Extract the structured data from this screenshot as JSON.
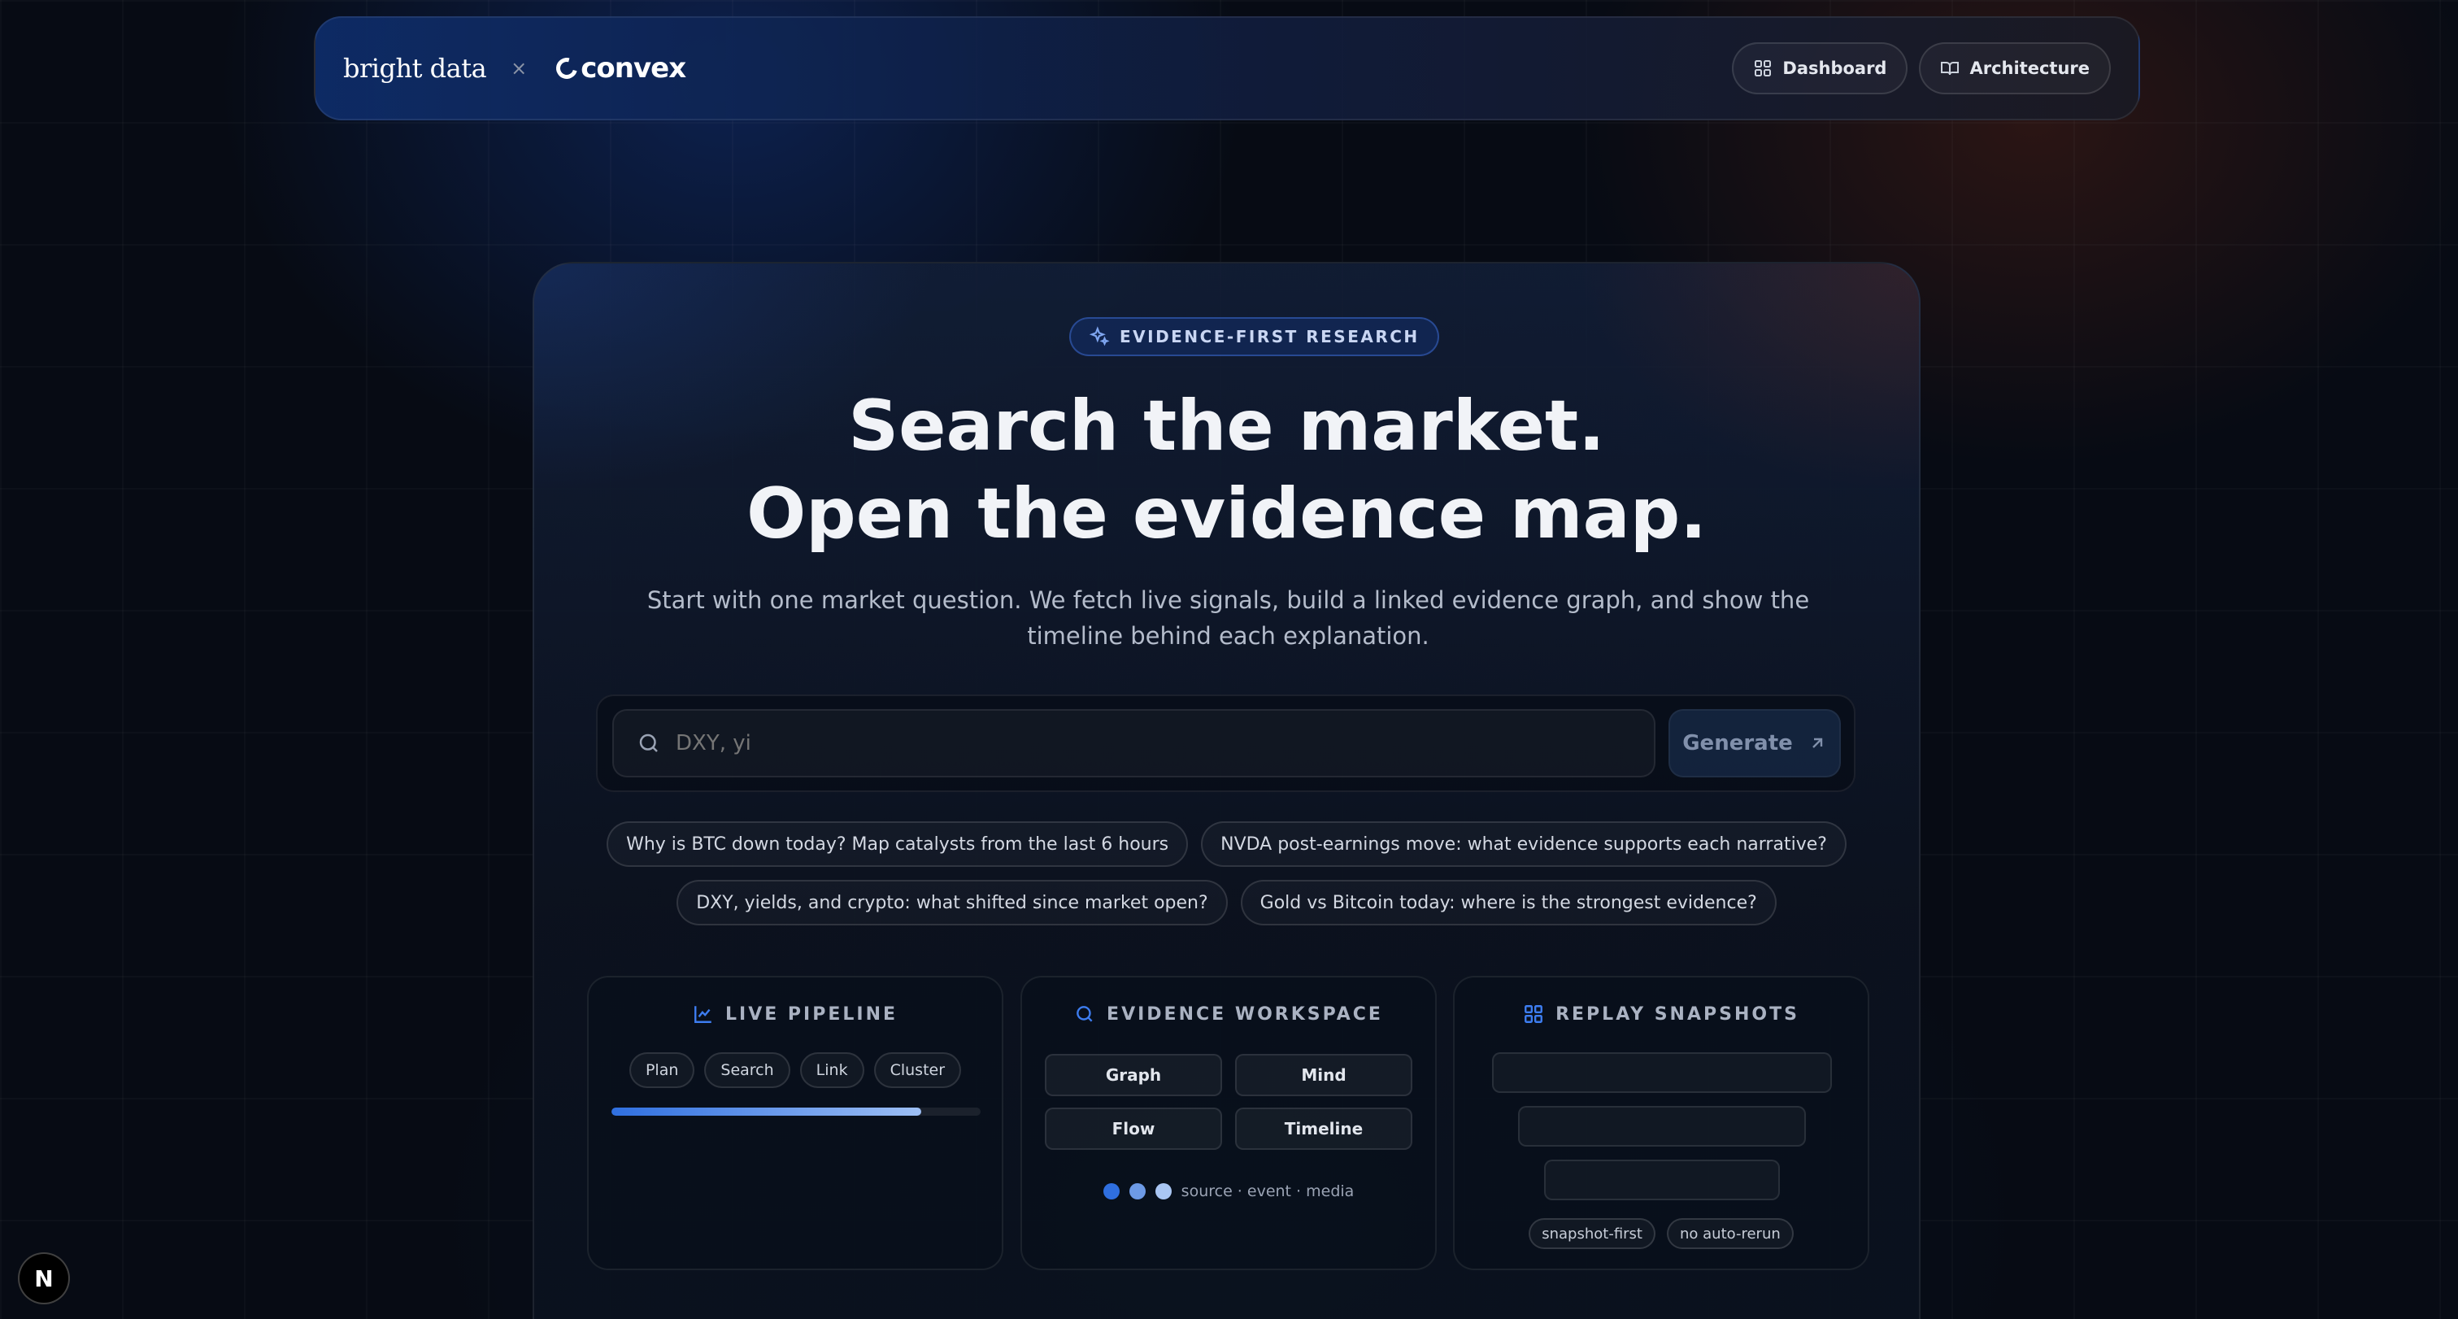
{
  "nav": {
    "brand_left": "bright data",
    "separator": "×",
    "brand_right": "convex",
    "dashboard_label": "Dashboard",
    "architecture_label": "Architecture"
  },
  "hero": {
    "badge": "EVIDENCE-FIRST RESEARCH",
    "title_line1": "Search the market.",
    "title_line2": "Open the evidence map.",
    "subtitle": "Start with one market question. We fetch live signals, build a linked evidence graph, and show the timeline behind each explanation."
  },
  "search": {
    "value": "",
    "placeholder": "DXY, yi",
    "generate_label": "Generate"
  },
  "suggestions": [
    "Why is BTC down today? Map catalysts from the last 6 hours",
    "NVDA post-earnings move: what evidence supports each narrative?",
    "DXY, yields, and crypto: what shifted since market open?",
    "Gold vs Bitcoin today: where is the strongest evidence?"
  ],
  "panels": {
    "pipeline": {
      "title": "LIVE PIPELINE",
      "steps": [
        "Plan",
        "Search",
        "Link",
        "Cluster"
      ],
      "progress": 0.84
    },
    "workspace": {
      "title": "EVIDENCE WORKSPACE",
      "views": [
        "Graph",
        "Mind",
        "Flow",
        "Timeline"
      ],
      "legend": "source · event · media",
      "dot_colors": [
        "#2f6fe0",
        "#6d9ae6",
        "#a9c6f3"
      ]
    },
    "snapshots": {
      "title": "REPLAY SNAPSHOTS",
      "tags": [
        "snapshot-first",
        "no auto-rerun"
      ]
    }
  },
  "dev_badge": "N",
  "colors": {
    "accent": "#2f6fe0",
    "background": "#070b14"
  }
}
